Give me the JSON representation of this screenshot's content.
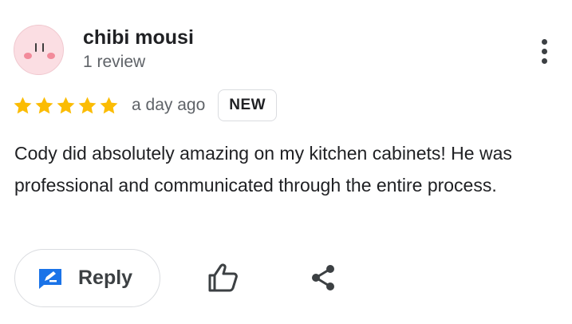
{
  "reviewer": {
    "name": "chibi mousi",
    "review_count": "1 review",
    "avatar_icon": "kirby-face-avatar"
  },
  "review": {
    "rating": 5,
    "rating_max": 5,
    "date": "a day ago",
    "badge": "NEW",
    "text": "Cody did absolutely amazing on my kitchen cabinets! He was professional and communicated through the entire process."
  },
  "actions": {
    "reply_label": "Reply",
    "reply_icon": "edit-reply-icon",
    "like_icon": "thumb-up-icon",
    "share_icon": "share-icon",
    "more_icon": "more-vert-icon"
  },
  "colors": {
    "star": "#fbbc04",
    "reply_icon": "#1a73e8",
    "text": "#202124",
    "secondary_text": "#5f6368",
    "avatar_bg": "#fbdee3"
  }
}
